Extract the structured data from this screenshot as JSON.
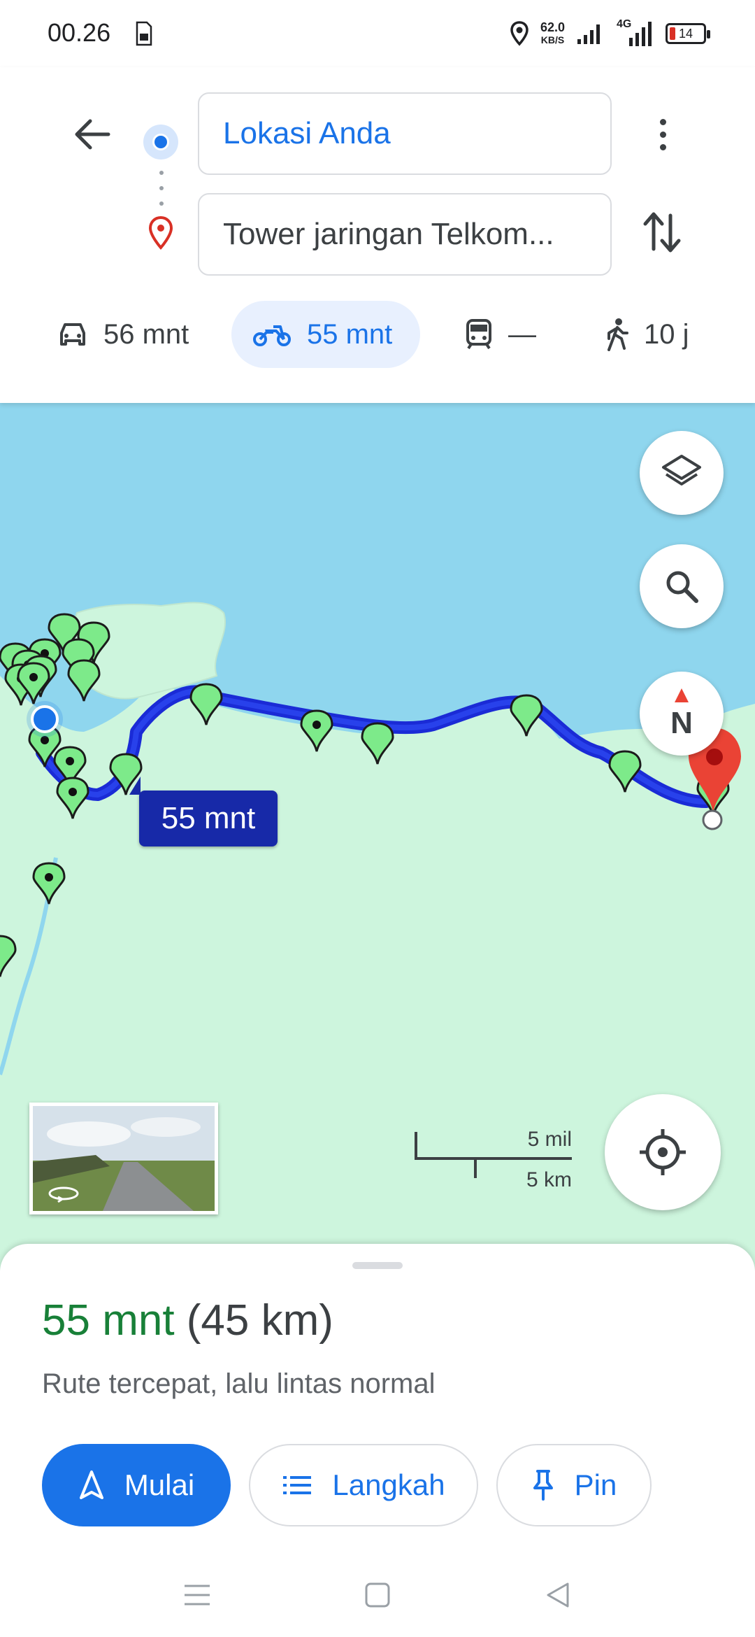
{
  "status_bar": {
    "time": "00.26",
    "net_speed_value": "62.0",
    "net_speed_unit": "KB/S",
    "network_type": "4G",
    "battery_level": "14"
  },
  "header": {
    "origin_value": "Lokasi Anda",
    "destination_value": "Tower jaringan Telkom...",
    "icons": [
      "back-arrow-icon",
      "origin-dot-icon",
      "destination-pin-icon",
      "more-vert-icon",
      "swap-icon"
    ]
  },
  "modes": [
    {
      "icon": "car-icon",
      "label": "56 mnt",
      "selected": false
    },
    {
      "icon": "motorcycle-icon",
      "label": "55 mnt",
      "selected": true
    },
    {
      "icon": "transit-icon",
      "label": "—",
      "selected": false
    },
    {
      "icon": "walk-icon",
      "label": "10 j",
      "selected": false
    }
  ],
  "map": {
    "route_label": "55 mnt",
    "compass_label": "N",
    "scale_top": "5 mil",
    "scale_bottom": "5 km",
    "colors": {
      "water": "#8fd6ee",
      "land": "#cdf5dd",
      "route": "#1a2bd6",
      "marker": "#7dea8a"
    }
  },
  "sheet": {
    "duration": "55 mnt",
    "distance": "(45 km)",
    "description": "Rute tercepat, lalu lintas normal",
    "actions": {
      "start_label": "Mulai",
      "steps_label": "Langkah",
      "pin_label": "Pin"
    }
  },
  "colors": {
    "accent": "#1a73e8",
    "duration_green": "#188038"
  }
}
